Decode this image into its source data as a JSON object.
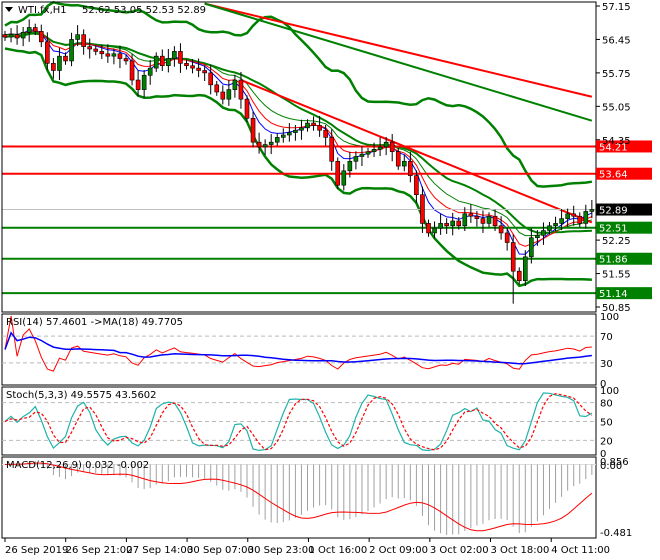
{
  "header": {
    "symbol_label": "WTI.fx,H1",
    "ohlc": "52.62 53.05 52.53 52.89"
  },
  "chart_data": {
    "type": "candlestick",
    "title": "WTI.fx,H1",
    "ylim": [
      50.85,
      57.15
    ],
    "price_ticks": [
      "57.15",
      "56.45",
      "55.75",
      "55.05",
      "54.35",
      "52.25",
      "51.55",
      "50.85"
    ],
    "current_price": "52.89",
    "levels": [
      {
        "value": 54.21,
        "label": "54.21",
        "color": "#ff0000"
      },
      {
        "value": 53.64,
        "label": "53.64",
        "color": "#ff0000"
      },
      {
        "value": 52.51,
        "label": "52.51",
        "color": "#008000"
      },
      {
        "value": 51.86,
        "label": "51.86",
        "color": "#008000"
      },
      {
        "value": 51.14,
        "label": "51.14",
        "color": "#008000"
      }
    ],
    "closes": [
      56.5,
      56.55,
      56.48,
      56.6,
      56.7,
      56.62,
      56.4,
      55.95,
      55.8,
      56.1,
      56.0,
      56.45,
      56.55,
      56.3,
      56.25,
      56.2,
      56.15,
      56.1,
      56.15,
      56.05,
      56.0,
      55.6,
      55.4,
      55.7,
      55.85,
      56.1,
      55.9,
      56.05,
      56.2,
      55.95,
      55.9,
      55.85,
      55.8,
      55.75,
      55.5,
      55.35,
      55.2,
      55.4,
      55.6,
      55.2,
      54.8,
      54.3,
      54.2,
      54.25,
      54.3,
      54.4,
      54.45,
      54.5,
      54.55,
      54.6,
      54.7,
      54.65,
      54.55,
      54.4,
      53.9,
      53.4,
      53.7,
      53.9,
      54.0,
      54.05,
      54.1,
      54.15,
      54.2,
      54.3,
      54.1,
      53.8,
      53.9,
      53.6,
      53.2,
      52.6,
      52.4,
      52.5,
      52.6,
      52.55,
      52.65,
      52.55,
      52.8,
      52.75,
      52.7,
      52.6,
      52.75,
      52.55,
      52.4,
      52.2,
      51.6,
      51.4,
      51.9,
      52.3,
      52.35,
      52.45,
      52.55,
      52.6,
      52.7,
      52.8,
      52.75,
      52.6,
      52.85,
      52.89
    ],
    "trendlines": [
      {
        "name": "upper-trendline",
        "from": [
          33,
          57.2
        ],
        "to": [
          97,
          55.25
        ],
        "color": "#ff0000"
      },
      {
        "name": "lower-trendline",
        "from": [
          39,
          55.6
        ],
        "to": [
          97,
          52.62
        ],
        "color": "#ff0000"
      },
      {
        "name": "long-ma",
        "from": [
          33,
          57.2
        ],
        "to": [
          97,
          54.75
        ],
        "color": "#008000"
      }
    ],
    "x_labels": [
      "26 Sep 2019",
      "26 Sep 21:00",
      "27 Sep 14:00",
      "30 Sep 07:00",
      "30 Sep 23:00",
      "1 Oct 16:00",
      "2 Oct 09:00",
      "3 Oct 02:00",
      "3 Oct 18:00",
      "4 Oct 11:00"
    ],
    "rsi": {
      "label": "RSI(14) 57.4601  ->MA(18) 49.7705",
      "ticks": [
        "100",
        "70",
        "30",
        "0"
      ]
    },
    "stoch": {
      "label": "Stoch(5,3,3) 49.5575 43.5602",
      "ticks": [
        "100",
        "80",
        "50",
        "20",
        "0"
      ]
    },
    "macd": {
      "label": "MACD(12,26,9) 0.032 -0.002",
      "ticks": [
        "0.856",
        "0.00",
        "-0.481"
      ]
    }
  }
}
